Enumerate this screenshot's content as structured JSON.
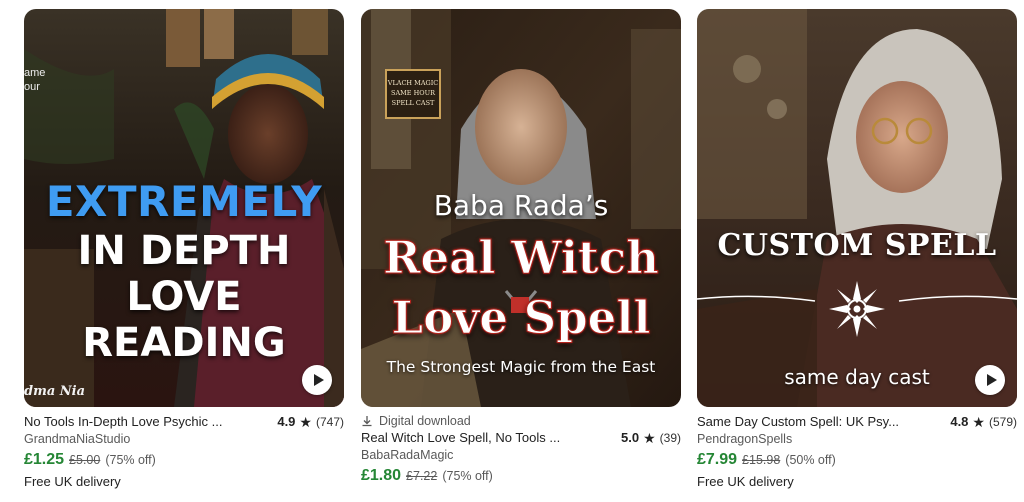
{
  "listings": [
    {
      "image": {
        "lines": [
          "EXTREMELY",
          "IN DEPTH",
          "LOVE",
          "READING"
        ],
        "edge_top": [
          "ame",
          "our"
        ],
        "signature": "dma Nia",
        "has_video": true
      },
      "title": "No Tools In-Depth Love Psychic ...",
      "rating": "4.9",
      "reviews": "(747)",
      "shop": "GrandmaNiaStudio",
      "price": "£1.25",
      "original_price": "£5.00",
      "discount": "(75% off)",
      "delivery": "Free UK delivery"
    },
    {
      "image": {
        "badge": [
          "VLACH MAGIC",
          "SAME HOUR",
          "SPELL CAST"
        ],
        "lines": [
          "Baba Rada’s",
          "Real Witch",
          "Love Spell",
          "The Strongest Magic from the East"
        ],
        "has_video": false
      },
      "digital_label": "Digital download",
      "title": "Real Witch Love Spell, No Tools ...",
      "rating": "5.0",
      "reviews": "(39)",
      "shop": "BabaRadaMagic",
      "price": "£1.80",
      "original_price": "£7.22",
      "discount": "(75% off)"
    },
    {
      "image": {
        "lines": [
          "CUSTOM SPELL",
          "same day cast"
        ],
        "has_video": true
      },
      "title": "Same Day Custom Spell: UK Psy...",
      "rating": "4.8",
      "reviews": "(579)",
      "shop": "PendragonSpells",
      "price": "£7.99",
      "original_price": "£15.98",
      "discount": "(50% off)",
      "delivery": "Free UK delivery"
    }
  ],
  "icons": {
    "star": "star-icon",
    "play": "play-icon",
    "download": "download-icon"
  },
  "colors": {
    "price_green": "#258635",
    "muted_text": "#595959",
    "headline_blue": "#3f9cf2",
    "spell_red": "#b3241e"
  }
}
